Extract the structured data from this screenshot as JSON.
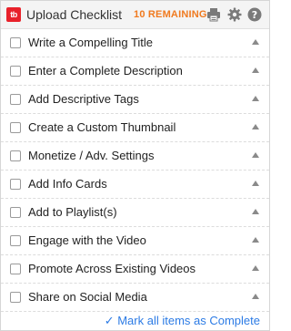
{
  "header": {
    "logo_text": "tb",
    "title": "Upload Checklist",
    "remaining": "10 REMAINING",
    "icons": [
      "print-icon",
      "gear-icon",
      "help-icon"
    ]
  },
  "items": [
    {
      "label": "Write a Compelling Title",
      "checked": false
    },
    {
      "label": "Enter a Complete Description",
      "checked": false
    },
    {
      "label": "Add Descriptive Tags",
      "checked": false
    },
    {
      "label": "Create a Custom Thumbnail",
      "checked": false
    },
    {
      "label": "Monetize / Adv. Settings",
      "checked": false
    },
    {
      "label": "Add Info Cards",
      "checked": false
    },
    {
      "label": "Add to Playlist(s)",
      "checked": false
    },
    {
      "label": "Engage with the Video",
      "checked": false
    },
    {
      "label": "Promote Across Existing Videos",
      "checked": false
    },
    {
      "label": "Share on Social Media",
      "checked": false
    }
  ],
  "footer": {
    "mark_all": "✓ Mark all items as Complete"
  },
  "colors": {
    "brand": "#e8212a",
    "remaining": "#f07a1f",
    "link": "#2c7be5",
    "header_bg": "#f4f4f4"
  }
}
